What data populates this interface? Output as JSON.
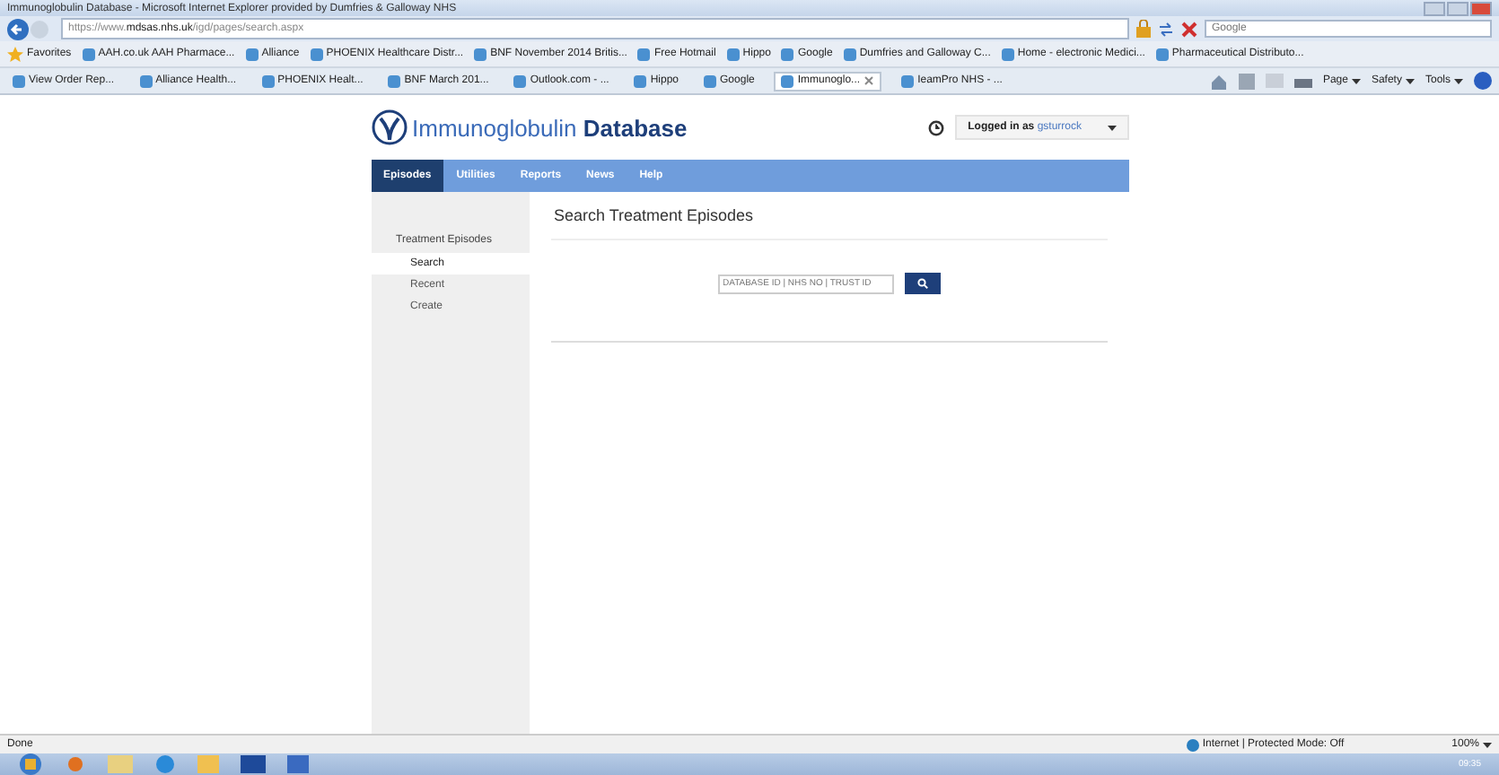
{
  "window": {
    "title": "Immunoglobulin Database - Microsoft Internet Explorer provided by Dumfries & Galloway NHS"
  },
  "address_bar": {
    "url": "https://www.**mdsas.nhs.uk**/igd/pages/search.aspx",
    "search_placeholder": "Google"
  },
  "favorites_bar": {
    "label": "Favorites",
    "items": [
      "AAH.co.uk AAH Pharmace...",
      "Alliance",
      "PHOENIX Healthcare Distr...",
      "BNF November 2014 Britis...",
      "Free Hotmail",
      "Hippo",
      "Google",
      "Dumfries and Galloway C...",
      "Home - electronic Medici...",
      "Pharmaceutical Distributo..."
    ]
  },
  "tabs": [
    {
      "label": "View Order Rep...",
      "selected": false
    },
    {
      "label": "Alliance Health...",
      "selected": false
    },
    {
      "label": "PHOENIX Healt...",
      "selected": false
    },
    {
      "label": "BNF March 201...",
      "selected": false
    },
    {
      "label": "Outlook.com - ...",
      "selected": false
    },
    {
      "label": "Hippo",
      "selected": false
    },
    {
      "label": "Google",
      "selected": false
    },
    {
      "label": "Immunoglo...",
      "selected": true
    },
    {
      "label": "IeamPro NHS - ...",
      "selected": false
    }
  ],
  "command_bar": [
    "Page",
    "Safety",
    "Tools"
  ],
  "app": {
    "logo": "Immunoglobulin **Database**",
    "login_label": "Logged in as",
    "username": "gsturrock",
    "nav": [
      {
        "label": "Episodes",
        "selected": true
      },
      {
        "label": "Utilities",
        "selected": false
      },
      {
        "label": "Reports",
        "selected": false
      },
      {
        "label": "News",
        "selected": false
      },
      {
        "label": "Help",
        "selected": false
      }
    ],
    "sidebar": {
      "heading": "Treatment Episodes",
      "items": [
        {
          "label": "Search",
          "selected": true
        },
        {
          "label": "Recent",
          "selected": false
        },
        {
          "label": "Create",
          "selected": false
        }
      ]
    },
    "page_title": "Search Treatment Episodes",
    "search_placeholder": "DATABASE ID | NHS NO | TRUST ID"
  },
  "status_bar": {
    "status": "Done",
    "zone": "Internet | Protected Mode: Off",
    "zoom": "100%"
  },
  "taskbar": {
    "time": "09:35"
  }
}
